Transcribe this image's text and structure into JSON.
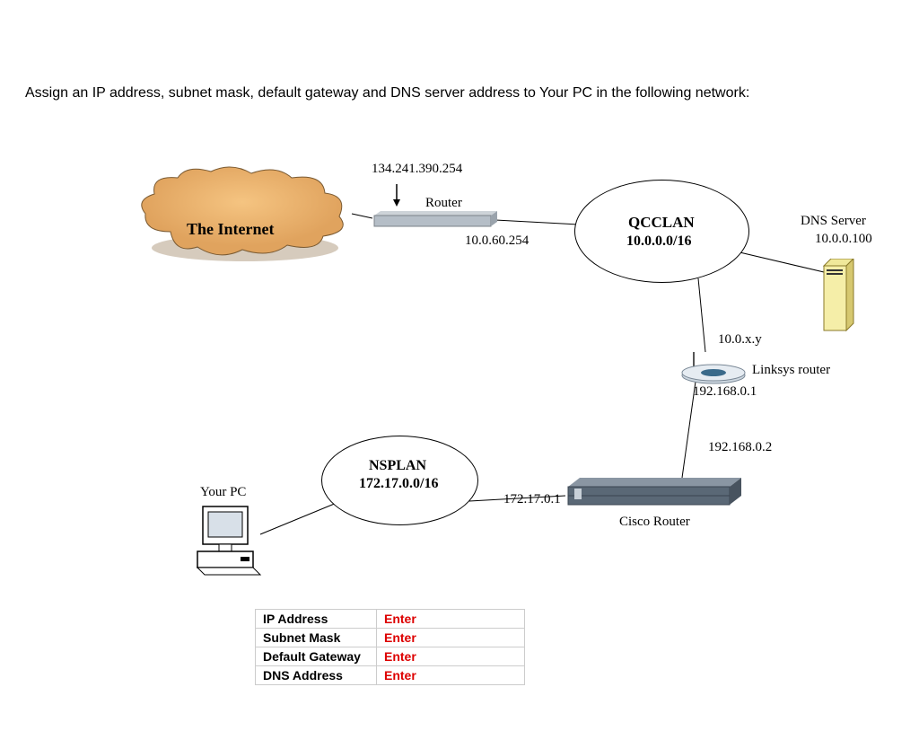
{
  "instruction": "Assign an IP address, subnet mask, default gateway and DNS server address to Your PC in the following network:",
  "cloud": {
    "label": "The Internet"
  },
  "edgeRouter": {
    "topIp": "134.241.390.254",
    "label": "Router",
    "bottomIp": "10.0.60.254"
  },
  "qcclan": {
    "name": "QCCLAN",
    "network": "10.0.0.0/16"
  },
  "dnsServer": {
    "label": "DNS Server",
    "ip": "10.0.0.100"
  },
  "linksys": {
    "wanIp": "10.0.x.y",
    "label": "Linksys router",
    "lanIp": "192.168.0.1"
  },
  "cisco": {
    "wanIp": "192.168.0.2",
    "lanIp": "172.17.0.1",
    "label": "Cisco Router"
  },
  "nsplan": {
    "name": "NSPLAN",
    "network": "172.17.0.0/16"
  },
  "pc": {
    "label": "Your PC"
  },
  "table": {
    "rows": [
      {
        "label": "IP Address",
        "value": "Enter"
      },
      {
        "label": "Subnet Mask",
        "value": "Enter"
      },
      {
        "label": "Default Gateway",
        "value": "Enter"
      },
      {
        "label": "DNS Address",
        "value": "Enter"
      }
    ]
  }
}
